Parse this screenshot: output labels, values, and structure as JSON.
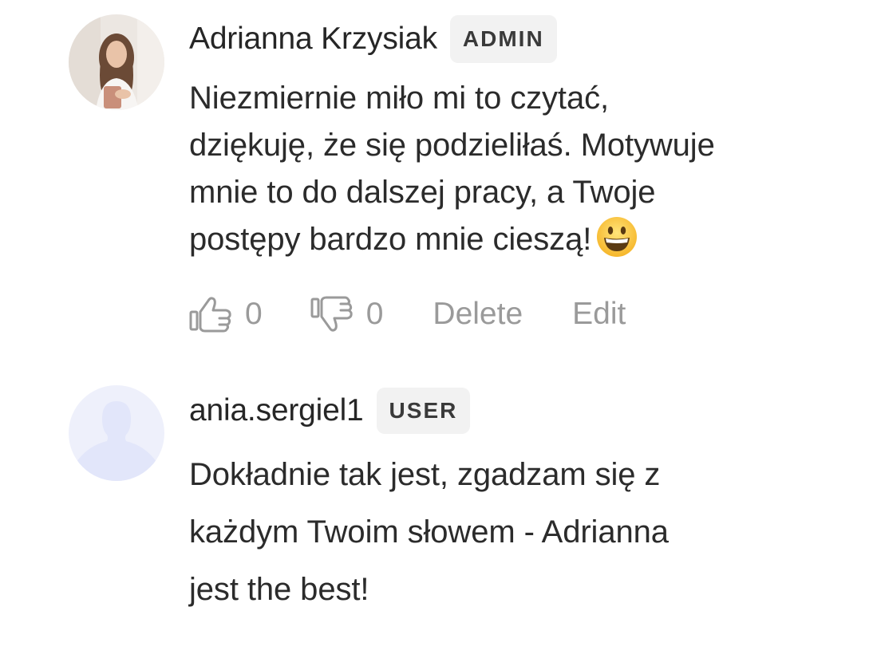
{
  "comments": [
    {
      "author": "Adrianna Krzysiak",
      "role": "ADMIN",
      "text": "Niezmiernie miło mi to czytać,\ndziękuję, że się podzieliłaś. Motywuje\nmnie to do dalszej pracy, a Twoje\npostępy bardzo mnie cieszą!",
      "emoji": "grinning-face-emoji",
      "likes": "0",
      "dislikes": "0",
      "delete_label": "Delete",
      "edit_label": "Edit",
      "avatar": "profile-photo"
    },
    {
      "author": "ania.sergiel1",
      "role": "USER",
      "text": "Dokładnie tak jest, zgadzam się z\nkażdym Twoim słowem - Adrianna\njest the best!",
      "avatar": "default-user-silhouette-icon"
    }
  ],
  "icons": {
    "like": "thumbs-up-icon",
    "dislike": "thumbs-down-icon"
  },
  "colors": {
    "text": "#2b2b2b",
    "muted": "#9a9a9a",
    "badge_bg": "#f2f2f2",
    "placeholder_avatar_bg": "#eef0fb",
    "placeholder_avatar_fg": "#e2e6fa"
  }
}
